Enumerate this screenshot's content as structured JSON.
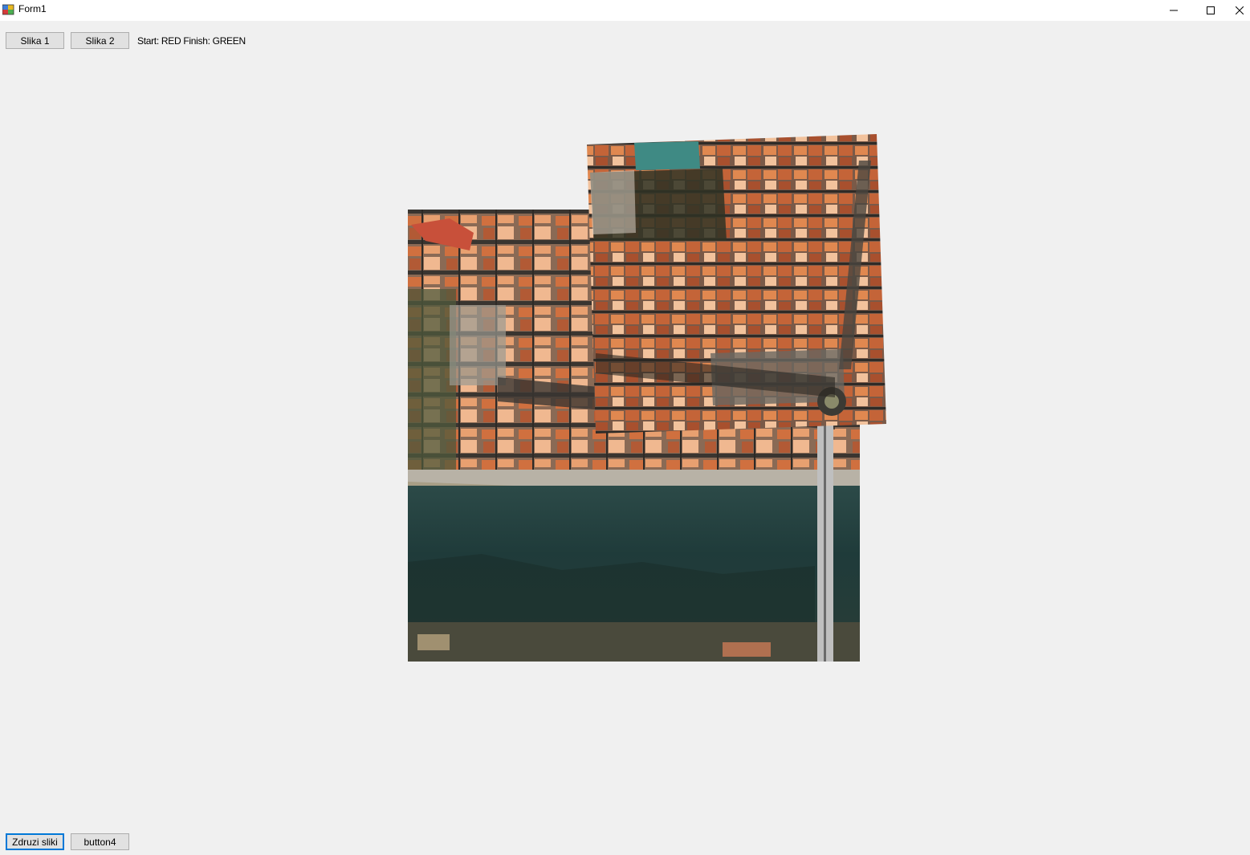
{
  "window": {
    "title": "Form1",
    "icon": "winforms-app-icon",
    "controls": {
      "minimize_icon": "minimize-icon",
      "maximize_icon": "maximize-icon",
      "close_icon": "close-icon"
    }
  },
  "toolbar_top": {
    "slika1_label": "Slika 1",
    "slika2_label": "Slika 2",
    "status_text": "Start: RED Finish: GREEN"
  },
  "toolbar_bottom": {
    "zdruzi_label": "Zdruzi sliki",
    "button4_label": "button4"
  },
  "colors": {
    "background": "#f0f0f0",
    "button_face": "#e1e1e1",
    "button_border": "#adadad",
    "focus_border": "#0078d7",
    "water": "#1f3a3a",
    "roof": "#c8643c",
    "shadow": "#2a2a24"
  }
}
